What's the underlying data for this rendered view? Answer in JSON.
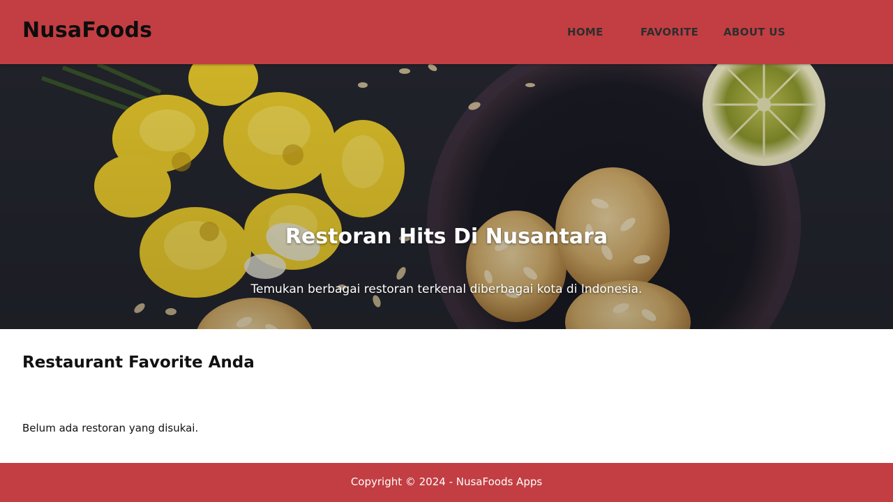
{
  "header": {
    "brand": "NusaFoods",
    "nav": [
      {
        "label": "HOME"
      },
      {
        "label": "FAVORITE"
      },
      {
        "label": "ABOUT US"
      }
    ]
  },
  "hero": {
    "title": "Restoran Hits Di Nusantara",
    "subtitle": "Temukan berbagai restoran terkenal diberbagai kota di Indonesia."
  },
  "main": {
    "title": "Restaurant Favorite Anda",
    "empty_message": "Belum ada restoran yang disukai."
  },
  "footer": {
    "text": "Copyright © 2024 - NusaFoods Apps"
  },
  "colors": {
    "brand": "#c23e42",
    "hero_bg": "#22242b"
  }
}
